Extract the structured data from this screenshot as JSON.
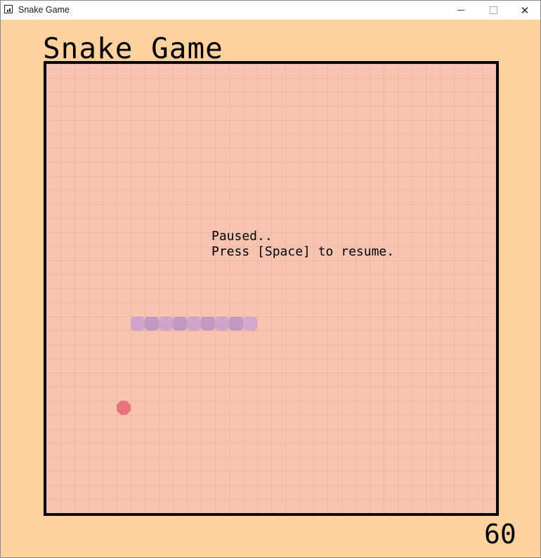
{
  "window": {
    "title": "Snake Game",
    "close_glyph": "✕"
  },
  "game": {
    "heading": "Snake Game",
    "status_line1": "Paused..",
    "status_line2": "Press [Space] to resume.",
    "score": "60"
  },
  "snake": {
    "segment_count": 9,
    "colors": [
      "#d0a4c8",
      "#c09ac0",
      "#d0a4c8",
      "#c09ac0",
      "#d0a4c8",
      "#c09ac0",
      "#d0a4c8",
      "#c09ac0",
      "#d4a8cc"
    ]
  },
  "food": {
    "color": "#e8727e"
  },
  "colors": {
    "background": "#fed29e",
    "board": "#f7c4b2",
    "border": "#000000"
  }
}
